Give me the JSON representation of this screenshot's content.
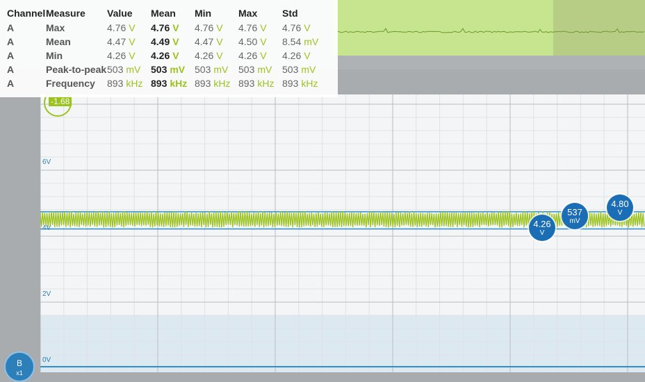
{
  "measure": {
    "headers": [
      "Channel",
      "Measure",
      "Value",
      "Mean",
      "Min",
      "Max",
      "Std"
    ],
    "rows": [
      {
        "channel": "A",
        "measure": "Max",
        "value": "4.76",
        "value_unit": "V",
        "mean": "4.76",
        "mean_unit": "V",
        "min": "4.76",
        "min_unit": "V",
        "max": "4.76",
        "max_unit": "V",
        "std": "4.76",
        "std_unit": "V"
      },
      {
        "channel": "A",
        "measure": "Mean",
        "value": "4.47",
        "value_unit": "V",
        "mean": "4.49",
        "mean_unit": "V",
        "min": "4.47",
        "min_unit": "V",
        "max": "4.50",
        "max_unit": "V",
        "std": "8.54",
        "std_unit": "mV"
      },
      {
        "channel": "A",
        "measure": "Min",
        "value": "4.26",
        "value_unit": "V",
        "mean": "4.26",
        "mean_unit": "V",
        "min": "4.26",
        "min_unit": "V",
        "max": "4.26",
        "max_unit": "V",
        "std": "4.26",
        "std_unit": "V"
      },
      {
        "channel": "A",
        "measure": "Peak-to-peak",
        "value": "503",
        "value_unit": "mV",
        "mean": "503",
        "mean_unit": "mV",
        "min": "503",
        "min_unit": "mV",
        "max": "503",
        "max_unit": "mV",
        "std": "503",
        "std_unit": "mV"
      },
      {
        "channel": "A",
        "measure": "Frequency",
        "value": "893",
        "value_unit": "kHz",
        "mean": "893",
        "mean_unit": "kHz",
        "min": "893",
        "min_unit": "kHz",
        "max": "893",
        "max_unit": "kHz",
        "std": "893",
        "std_unit": "kHz"
      }
    ]
  },
  "plot": {
    "y_labels": [
      "6V",
      "4V",
      "2V",
      "0V"
    ],
    "trigger_label": "-1.68",
    "trace_color": "#9bc31d",
    "ref_line_color": "#2c8fd0",
    "signal": {
      "min_v": 4.26,
      "max_v": 4.76
    }
  },
  "markers": [
    {
      "value": "4.26",
      "unit": "V"
    },
    {
      "value": "537",
      "unit": "mV"
    },
    {
      "value": "4.80",
      "unit": "V"
    }
  ],
  "channel_b": {
    "label": "B",
    "sublabel": "x1"
  },
  "colors": {
    "accent_green": "#9bc31d",
    "marker_blue": "#1b6eb5",
    "channel_blue": "#2c7fb8"
  }
}
